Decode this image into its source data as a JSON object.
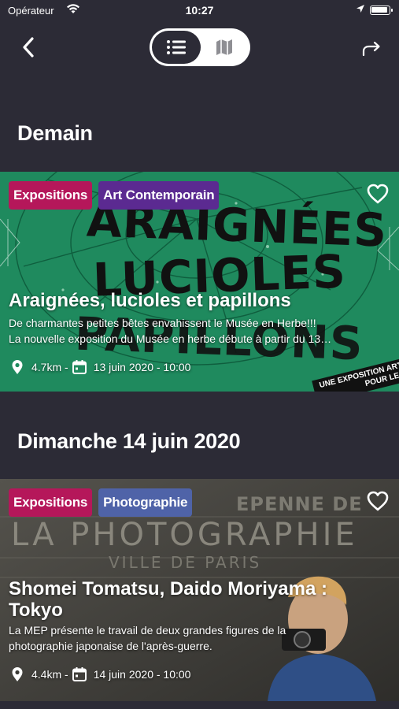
{
  "status_bar": {
    "carrier": "Opérateur",
    "time": "10:27"
  },
  "nav": {
    "back_icon": "chevron-left-icon",
    "list_icon": "list-icon",
    "map_icon": "map-icon",
    "share_icon": "share-icon",
    "active_view": "list"
  },
  "sections": [
    {
      "title": "Demain",
      "event": {
        "tags": [
          {
            "label": "Expositions",
            "color": "#b5175a"
          },
          {
            "label": "Art Contemporain",
            "color": "#5b2a91"
          }
        ],
        "title": "Araignées, lucioles et papillons",
        "description_lines": [
          "De charmantes petites bêtes envahissent le Musée en Herbe!!!",
          "La nouvelle exposition du Musée en herbe débute à partir du 13…"
        ],
        "distance": "4.7km -",
        "date": "13 juin 2020 - 10:00",
        "favorite": false,
        "artwork": {
          "words": [
            "ARAIGNÉES",
            "LUCIOLES",
            "PAPILLONS"
          ],
          "stamp_lines": [
            "UNE EXPOSITION ART",
            "POUR LES"
          ]
        }
      }
    },
    {
      "title": "Dimanche 14 juin 2020",
      "event": {
        "tags": [
          {
            "label": "Expositions",
            "color": "#b5175a"
          },
          {
            "label": "Photographie",
            "color": "#4f63a8"
          }
        ],
        "title_lines": [
          "Shomei Tomatsu, Daido Moriyama :",
          "Tokyo"
        ],
        "description_lines": [
          "La MEP présente le travail de deux grandes figures de la",
          "photographie japonaise de l'après-guerre."
        ],
        "distance": "4.4km -",
        "date": "14 juin 2020 - 10:00",
        "favorite": false,
        "artwork": {
          "words": [
            "EPENNE DE",
            "LA PHOTOGRAPHIE",
            "VILLE DE PARIS"
          ]
        }
      }
    }
  ]
}
